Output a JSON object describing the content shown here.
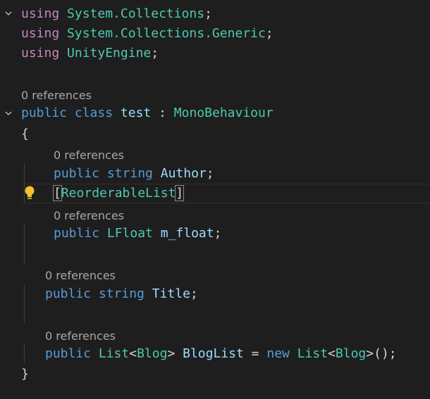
{
  "code": {
    "line1": {
      "kw": "using",
      "ns": "System.Collections",
      "end": ";"
    },
    "line2": {
      "kw": "using",
      "ns": "System.Collections.Generic",
      "end": ";"
    },
    "line3": {
      "kw": "using",
      "ns": "UnityEngine",
      "end": ";"
    },
    "ref_class": "0 references",
    "class_line": {
      "kw1": "public",
      "kw2": "class",
      "name": "test",
      "colon": ":",
      "base": "MonoBehaviour"
    },
    "open_brace": "{",
    "ref_author": "0 references",
    "author_line": {
      "kw1": "public",
      "kw2": "string",
      "name": "Author",
      "end": ";"
    },
    "attr_line": {
      "open": "[",
      "name": "ReorderableList",
      "close": "]"
    },
    "ref_float": "0 references",
    "float_line": {
      "kw1": "public",
      "type": "LFloat",
      "name": "m_float",
      "end": ";"
    },
    "ref_title": "0 references",
    "title_line": {
      "kw1": "public",
      "kw2": "string",
      "name": "Title",
      "end": ";"
    },
    "ref_bloglist": "0 references",
    "bloglist_line": {
      "kw1": "public",
      "type1": "List",
      "lt": "<",
      "arg": "Blog",
      "gt": ">",
      "name": "BlogList",
      "eq": "=",
      "kwnew": "new",
      "type2": "List",
      "lt2": "<",
      "arg2": "Blog",
      "gt2": ">",
      "end": "();"
    },
    "close_brace": "}"
  },
  "icons": {
    "fold": "chevron-down-icon",
    "bulb": "lightbulb-icon"
  },
  "colors": {
    "background": "#1e1e1e",
    "keyword": "#569cd6",
    "using": "#c586c0",
    "type": "#4ec9b0",
    "identifier": "#9cdcfe",
    "codelens": "#a8a8a8"
  }
}
